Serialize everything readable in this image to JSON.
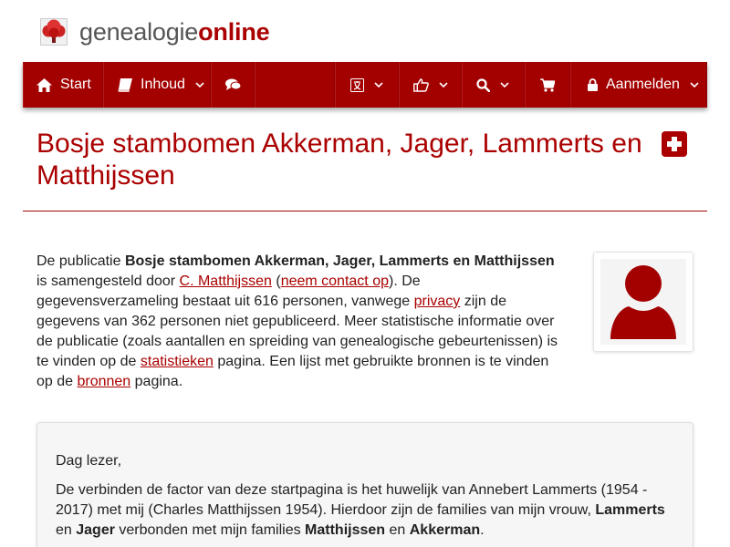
{
  "site": {
    "name_a": "genealogie",
    "name_b": "online"
  },
  "nav": {
    "start": "Start",
    "inhoud": "Inhoud",
    "login": "Aanmelden",
    "icons": [
      "home-icon",
      "book-icon",
      "comments-icon",
      "language-icon",
      "thumbs-up-icon",
      "search-icon",
      "cart-icon",
      "lock-icon",
      "chevron-down-icon"
    ]
  },
  "page": {
    "title": "Bosje stambomen Akkerman, Jager, Lammerts en Matthijssen"
  },
  "intro": {
    "t1": "De publicatie ",
    "pub_name": "Bosje stambomen Akkerman, Jager, Lammerts en Matthijssen",
    "t2": " is samengesteld door ",
    "author_link": "C. Matthijssen",
    "t3": " (",
    "contact_link": "neem contact op",
    "t4": "). De gegevensverzameling bestaat uit 616 personen, vanwege ",
    "privacy_link": "privacy",
    "t5": " zijn de gegevens van 362 personen niet gepubliceerd. Meer statistische informatie over de publicatie (zoals aantallen en spreiding van genealogische gebeurtenissen) is te vinden op de ",
    "stats_link": "statistieken",
    "t6": " pagina. Een lijst met gebruikte bronnen is te vinden op de ",
    "sources_link": "bronnen",
    "t7": " pagina."
  },
  "letter": {
    "greeting": "Dag lezer,",
    "p1": "De verbinden de factor van deze startpagina  is het huwelijk van Annebert Lammerts (1954 - 2017) met mij (Charles Matthijssen 1954). Hierdoor zijn de families van mijn vrouw, ",
    "b1": "Lammerts",
    "p2": " en ",
    "b2": "Jager",
    "p3": " verbonden met mijn families ",
    "b3": "Matthijssen",
    "p4": " en ",
    "b4": "Akkerman",
    "p5": "."
  },
  "colors": {
    "brand": "#a30000",
    "link": "#aa0000"
  }
}
